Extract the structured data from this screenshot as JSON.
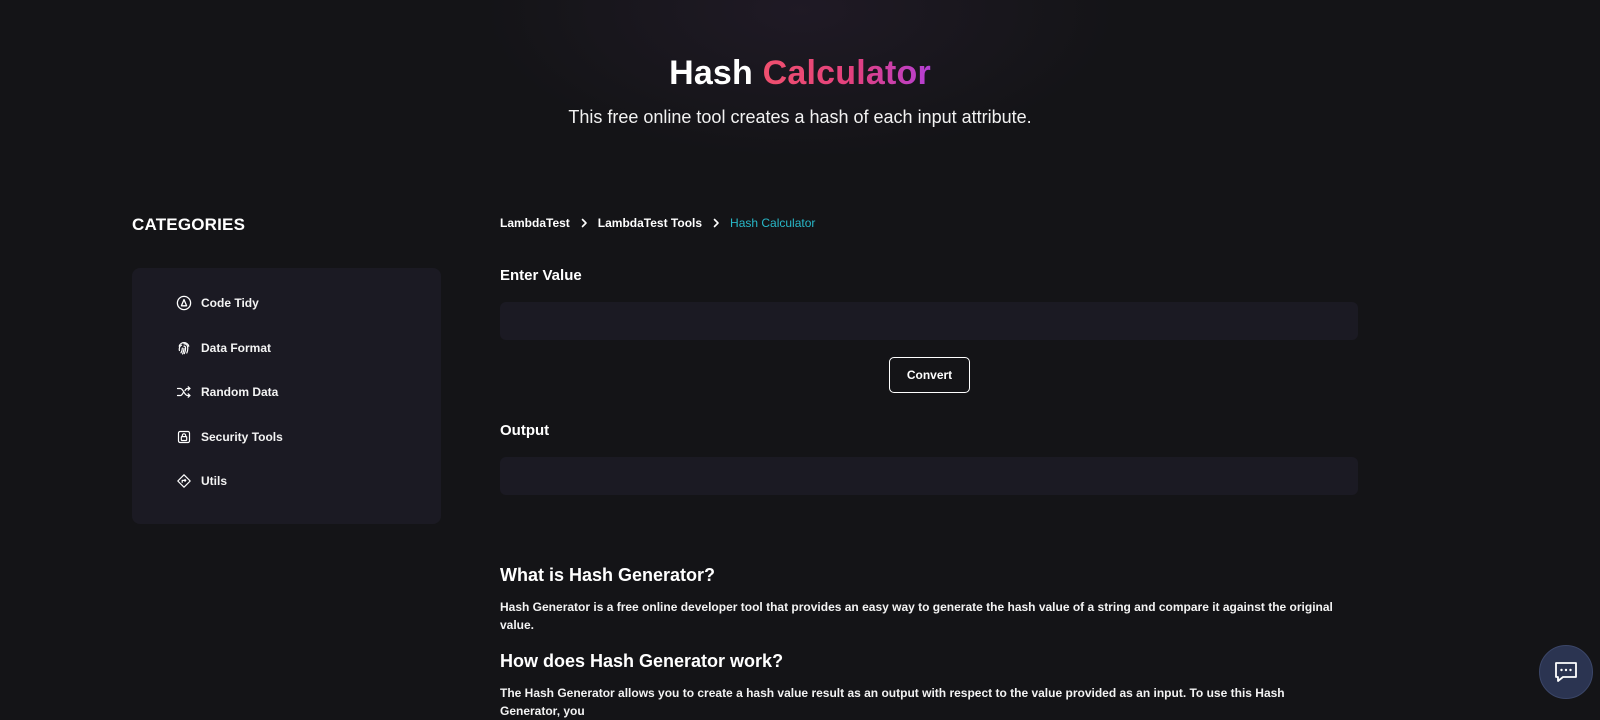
{
  "hero": {
    "title_main": "Hash",
    "title_accent": "Calculator",
    "subtitle": "This free online tool creates a hash of each input attribute."
  },
  "sidebar": {
    "heading": "CATEGORIES",
    "items": [
      {
        "label": "Code Tidy",
        "icon": "code-tidy-icon"
      },
      {
        "label": "Data Format",
        "icon": "fingerprint-icon"
      },
      {
        "label": "Random Data",
        "icon": "shuffle-icon"
      },
      {
        "label": "Security Tools",
        "icon": "lock-icon"
      },
      {
        "label": "Utils",
        "icon": "diamond-icon"
      }
    ]
  },
  "breadcrumb": {
    "items": [
      "LambdaTest",
      "LambdaTest Tools"
    ],
    "current": "Hash Calculator"
  },
  "form": {
    "input_label": "Enter Value",
    "input_value": "",
    "input_placeholder": "",
    "convert_label": "Convert",
    "output_label": "Output",
    "output_value": ""
  },
  "article": {
    "what_heading": "What is Hash Generator?",
    "what_text": "Hash Generator is a free online developer tool that provides an easy way to generate the hash value of a string and compare it against the original value.",
    "how_heading": "How does Hash Generator work?",
    "how_text": "The Hash Generator allows you to create a hash value result as an output with respect to the value provided as an input. To use this Hash Generator, you"
  },
  "chat": {
    "icon": "chat-icon"
  },
  "colors": {
    "background": "#141417",
    "panel": "#1b1a23",
    "accent_teal": "#28b8c8",
    "accent_gradient_start": "#f0506e",
    "accent_gradient_end": "#b43fd6",
    "chat_button": "#2b3451"
  }
}
